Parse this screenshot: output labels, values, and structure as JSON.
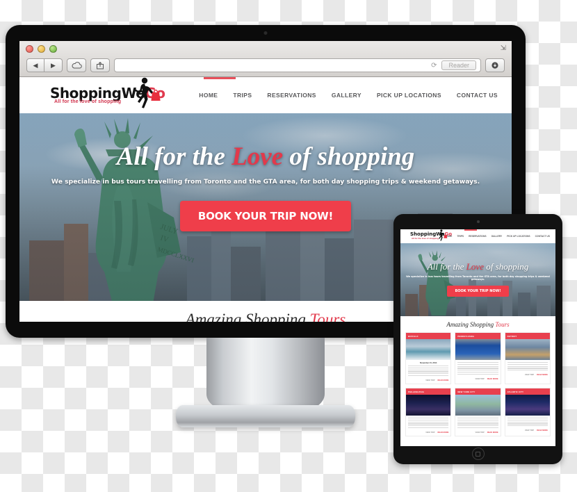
{
  "browser": {
    "back_icon": "back-arrow-icon",
    "forward_icon": "forward-arrow-icon",
    "cloud_icon": "icloud-icon",
    "share_icon": "share-icon",
    "url_value": "",
    "url_placeholder": "",
    "reload_icon": "reload-icon",
    "reader_label": "Reader",
    "downloads_icon": "downloads-icon",
    "expand_icon": "fullscreen-expand-icon",
    "traffic_lights": {
      "close": "#e35449",
      "minimize": "#e0ab35",
      "zoom": "#63ab39"
    }
  },
  "site": {
    "logo": {
      "word_part1": "Shopping",
      "word_part2": "We",
      "word_part3": "Go",
      "tagline": "All for the love of shopping",
      "mark": "shopping-girl-silhouette-icon"
    },
    "nav": [
      {
        "label": "HOME"
      },
      {
        "label": "TRIPS"
      },
      {
        "label": "RESERVATIONS"
      },
      {
        "label": "GALLERY"
      },
      {
        "label": "PICK UP LOCATIONS"
      },
      {
        "label": "CONTACT US"
      }
    ],
    "hero": {
      "title_part1": "All for the ",
      "title_highlight": "Love",
      "title_part2": " of shopping",
      "subtitle": "We specialize in bus tours travelling from Toronto and the GTA area, for both day shopping trips & weekend getaways.",
      "cta_label": "BOOK YOUR TRIP NOW!",
      "background_image": "statue-of-liberty-nyc-skyline-photo"
    },
    "tours": {
      "heading_part1": "Amazing Shopping ",
      "heading_highlight": "Tours"
    },
    "colors": {
      "accent_red": "#e8404e",
      "cta_red": "#ef3e4a",
      "logo_red": "#e03a4e",
      "nav_text": "#58585a"
    }
  },
  "tablet": {
    "tours_heading_part1": "Amazing Shopping ",
    "tours_heading_highlight": "Tours",
    "cards": [
      {
        "tag": "BUFFALO",
        "image": "niagara-falls-photo",
        "date": "November 21, 2014",
        "link_more": "READ MORE",
        "link_view": "VIEW TRIP"
      },
      {
        "tag": "PENNSYLVANIA",
        "image": "pennsylvania-welcome-sign-photo",
        "date": "",
        "link_more": "READ MORE",
        "link_view": "VIEW TRIP"
      },
      {
        "tag": "DETROIT",
        "image": "modern-building-photo",
        "date": "",
        "link_more": "READ MORE",
        "link_view": "VIEW TRIP"
      },
      {
        "tag": "PHILADELPHIA",
        "image": "city-skyline-night-photo",
        "date": "",
        "link_more": "READ MORE",
        "link_view": "VIEW TRIP"
      },
      {
        "tag": "NEW YORK CITY",
        "image": "statue-of-liberty-photo",
        "date": "",
        "link_more": "READ MORE",
        "link_view": "VIEW TRIP"
      },
      {
        "tag": "ATLANTIC CITY",
        "image": "waterfront-skyline-night-photo",
        "date": "",
        "link_more": "READ MORE",
        "link_view": "VIEW TRIP"
      }
    ],
    "home_button": "home-button"
  }
}
